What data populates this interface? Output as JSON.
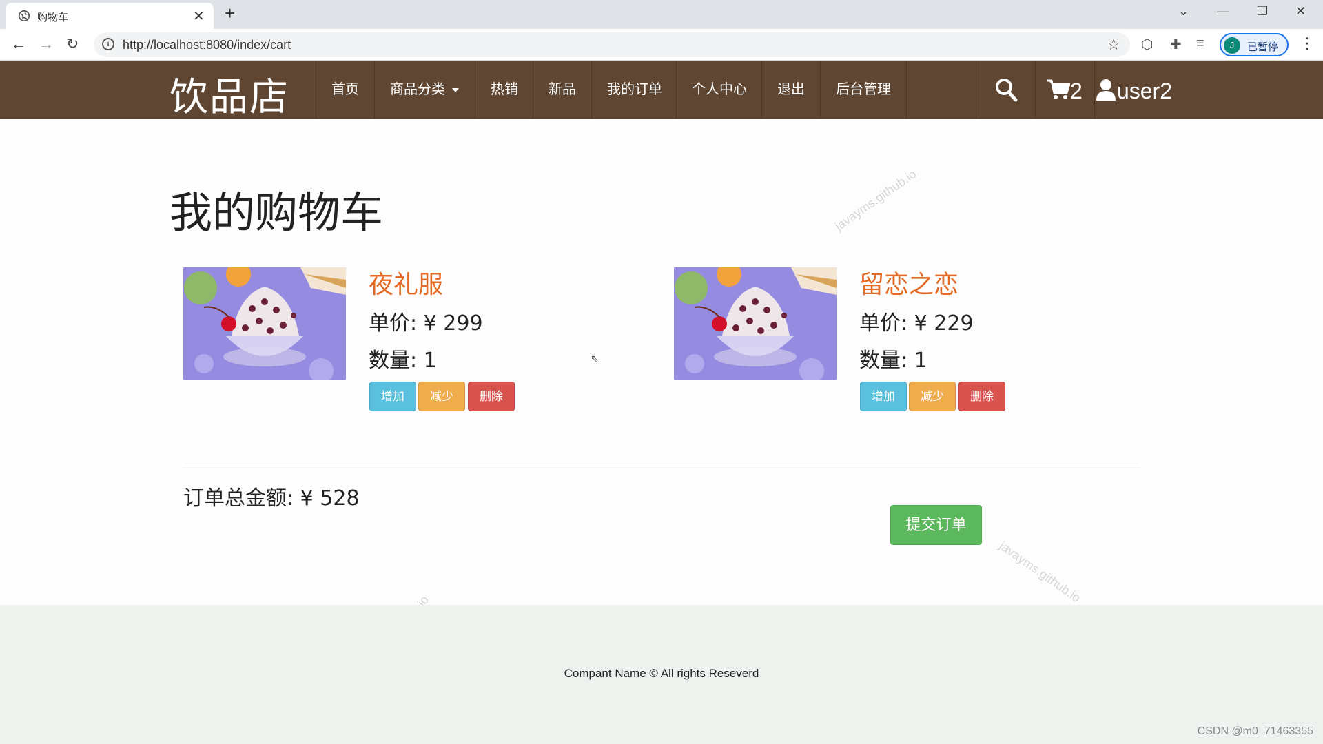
{
  "browser": {
    "tab_title": "购物车",
    "url": "http://localhost:8080/index/cart",
    "profile_initial": "J",
    "profile_status": "已暂停"
  },
  "navbar": {
    "brand": "饮品店",
    "items": [
      {
        "label": "首页"
      },
      {
        "label": "商品分类"
      },
      {
        "label": "热销"
      },
      {
        "label": "新品"
      },
      {
        "label": "我的订单"
      },
      {
        "label": "个人中心"
      },
      {
        "label": "退出"
      },
      {
        "label": "后台管理"
      }
    ],
    "cart_count": "2",
    "username": "user2"
  },
  "page": {
    "title": "我的购物车"
  },
  "cart": {
    "items": [
      {
        "name": "夜礼服",
        "price_text": "单价: ¥ 299",
        "qty_text": "数量: 1"
      },
      {
        "name": "留恋之恋",
        "price_text": "单价: ¥ 229",
        "qty_text": "数量: 1"
      }
    ],
    "add_label": "增加",
    "minus_label": "减少",
    "delete_label": "删除",
    "total_text": "订单总金额: ¥ 528",
    "submit_label": "提交订单"
  },
  "watermark_text": "javayms.github.io",
  "footer": {
    "text": "Compant Name © All rights Reseverd",
    "credit": "CSDN @m0_71463355"
  }
}
